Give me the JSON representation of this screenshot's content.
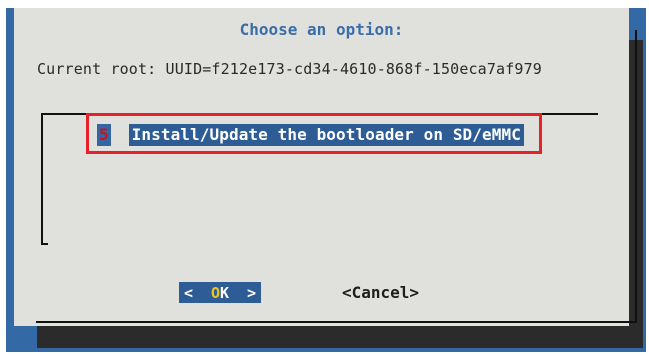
{
  "dialog": {
    "title": "Choose an option:",
    "current_root": "Current root: UUID=f212e173-cd34-4610-868f-150eca7af979"
  },
  "menu": {
    "items": [
      {
        "tag": "5",
        "label": "Install/Update the bootloader on SD/eMMC"
      }
    ]
  },
  "buttons": {
    "ok_left": "<",
    "ok_hotkey": "O",
    "ok_rest": "K",
    "ok_right": ">",
    "cancel": "<Cancel>"
  },
  "colors": {
    "background": "#3369a4",
    "dialog": "#e0e0dc",
    "title": "#3a6ea8",
    "selection": "#2e5d96",
    "tag": "#c4161c",
    "hotkey": "#f0c419",
    "annotation": "#e8202a"
  }
}
